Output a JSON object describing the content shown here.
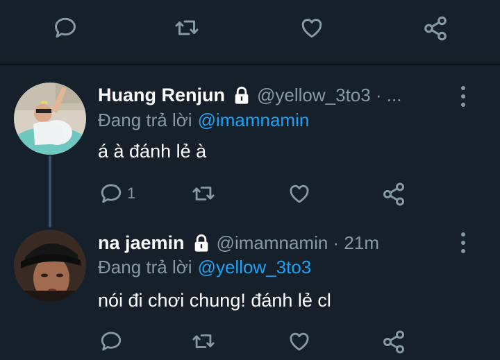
{
  "top_actions": {
    "reply_icon": "reply-icon",
    "retweet_icon": "retweet-icon",
    "like_icon": "heart-icon",
    "share_icon": "share-icon"
  },
  "tweets": [
    {
      "name": "Huang Renjun",
      "locked": true,
      "handle": "@yellow_3to3 · ...",
      "replying_label": "Đang trả lời",
      "replying_to": "@imamnamin",
      "text": "á à đánh lẻ à",
      "reply_count": "1",
      "avatar_colors": [
        "#c9c2b4",
        "#e8eef0",
        "#6ec7c0"
      ]
    },
    {
      "name": "na jaemin",
      "locked": true,
      "handle": "@imamnamin · 21m",
      "replying_label": "Đang trả lời",
      "replying_to": "@yellow_3to3",
      "text": "nói đi chơi chung! đánh lẻ cl",
      "reply_count": "",
      "avatar_colors": [
        "#1b1b1b",
        "#a06b4f",
        "#3a2a24"
      ]
    }
  ],
  "colors": {
    "background": "#15202b",
    "text": "#ffffff",
    "muted": "#8899a6",
    "link": "#1da1f2",
    "thread_line": "#3d5466"
  }
}
